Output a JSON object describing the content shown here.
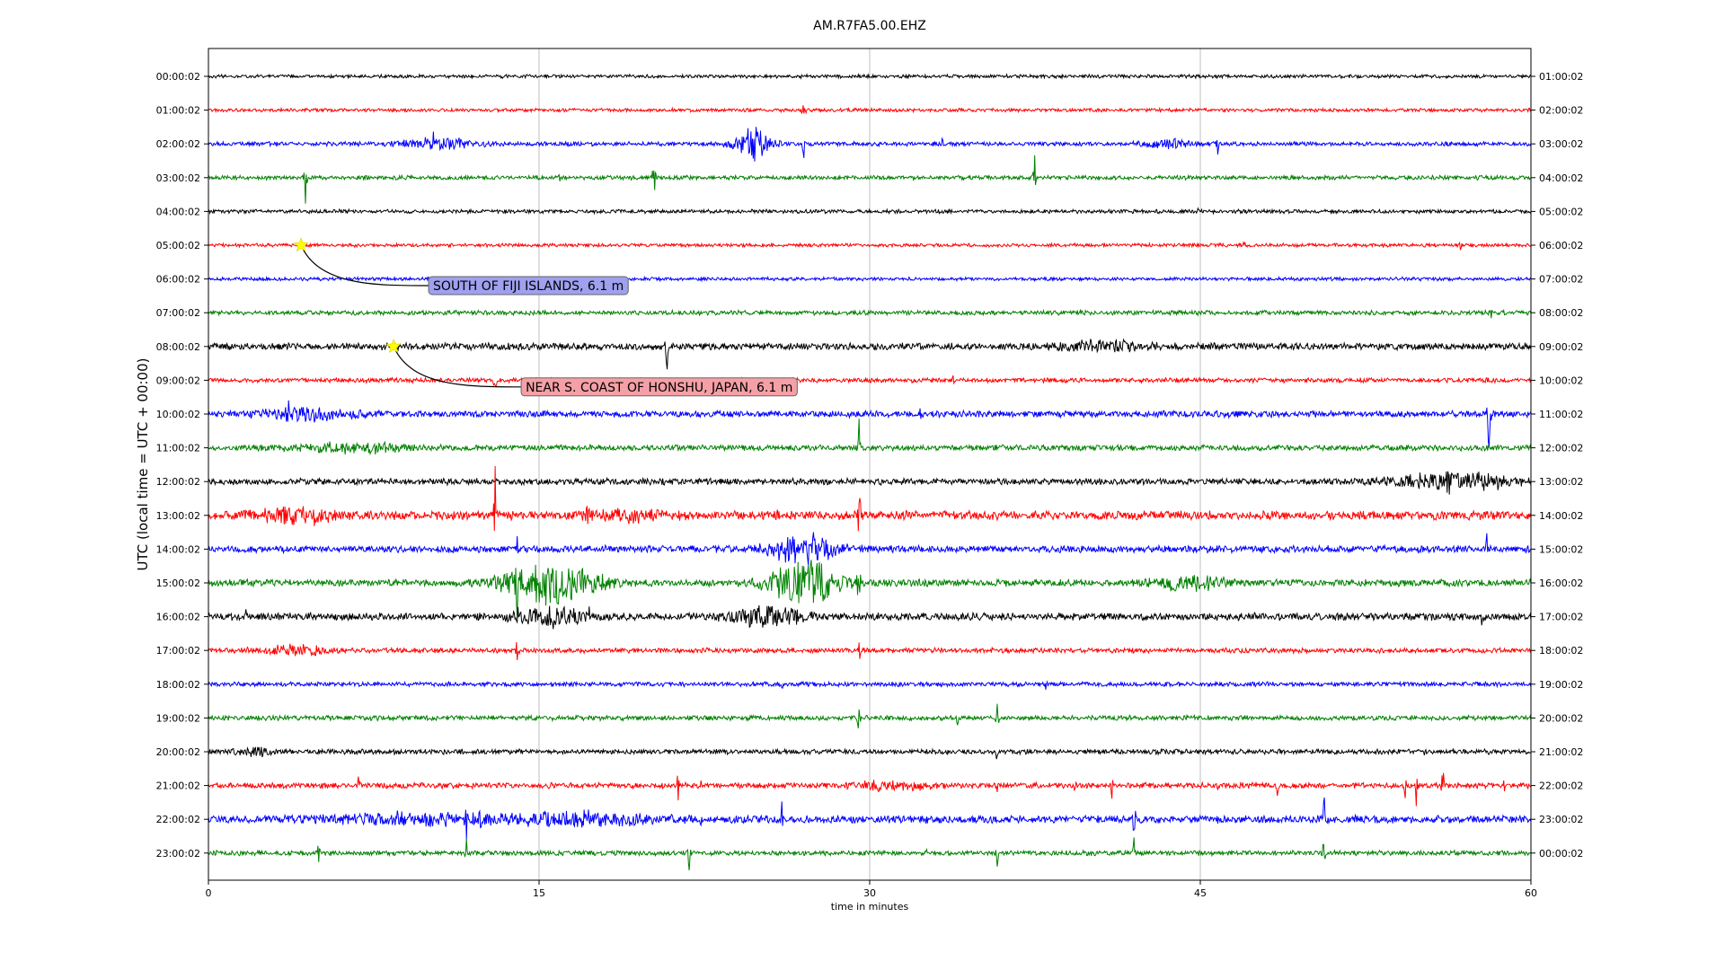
{
  "chart_data": {
    "type": "line",
    "title": "AM.R7FA5.00.EHZ",
    "xlabel": "time in minutes",
    "ylabel": "UTC (local time = UTC + 00:00)",
    "xlim": [
      0,
      60
    ],
    "x_ticks": [
      "0",
      "15",
      "30",
      "45",
      "60"
    ],
    "x_tick_values": [
      0,
      15,
      30,
      45,
      60
    ],
    "grid": "vertical lines at each x tick",
    "trace_colors": [
      "#000000",
      "#ff0000",
      "#0000ff",
      "#008000"
    ],
    "left_tick_labels": [
      "00:00:02",
      "01:00:02",
      "02:00:02",
      "03:00:02",
      "04:00:02",
      "05:00:02",
      "06:00:02",
      "07:00:02",
      "08:00:02",
      "09:00:02",
      "10:00:02",
      "11:00:02",
      "12:00:02",
      "13:00:02",
      "14:00:02",
      "15:00:02",
      "16:00:02",
      "17:00:02",
      "18:00:02",
      "19:00:02",
      "20:00:02",
      "21:00:02",
      "22:00:02",
      "23:00:02"
    ],
    "right_tick_labels": [
      "01:00:02",
      "02:00:02",
      "03:00:02",
      "04:00:02",
      "05:00:02",
      "06:00:02",
      "07:00:02",
      "08:00:02",
      "09:00:02",
      "10:00:02",
      "11:00:02",
      "12:00:02",
      "13:00:02",
      "14:00:02",
      "15:00:02",
      "16:00:02",
      "17:00:02",
      "18:00:02",
      "19:00:02",
      "20:00:02",
      "21:00:02",
      "22:00:02",
      "23:00:02",
      "00:00:02"
    ],
    "events": [
      {
        "label": "SOUTH OF FIJI ISLANDS, 6.1 m",
        "row": 5,
        "minute": 4.2,
        "box_color": "#9fa0ee"
      },
      {
        "label": "NEAR S. COAST OF HONSHU, JAPAN, 6.1 m",
        "row": 8,
        "minute": 8.4,
        "box_color": "#f5a0a6"
      }
    ],
    "series": [
      {
        "noise": 1.0,
        "bursts": [],
        "spikes": []
      },
      {
        "noise": 1.0,
        "bursts": [],
        "spikes": [
          {
            "minute": 27.0,
            "amp": 30
          }
        ]
      },
      {
        "noise": 1.2,
        "bursts": [
          {
            "minute": 10.5,
            "width": 1.5,
            "amp": 7
          },
          {
            "minute": 24.7,
            "width": 0.8,
            "amp": 20
          },
          {
            "minute": 43.5,
            "width": 1.0,
            "amp": 5
          }
        ],
        "spikes": [
          {
            "minute": 10.2,
            "amp": 28
          },
          {
            "minute": 27.0,
            "amp": 28
          },
          {
            "minute": 45.8,
            "amp": 34
          },
          {
            "minute": 33.3,
            "amp": 14
          }
        ]
      },
      {
        "noise": 1.2,
        "bursts": [],
        "spikes": [
          {
            "minute": 4.4,
            "amp": 34
          },
          {
            "minute": 20.2,
            "amp": 34
          },
          {
            "minute": 37.5,
            "amp": 28
          },
          {
            "minute": 15.9,
            "amp": 12
          }
        ]
      },
      {
        "noise": 1.1,
        "bursts": [],
        "spikes": [
          {
            "minute": 44.9,
            "amp": 6
          }
        ]
      },
      {
        "noise": 1.0,
        "bursts": [],
        "spikes": [
          {
            "minute": 47.0,
            "amp": 8
          },
          {
            "minute": 56.8,
            "amp": 8
          }
        ]
      },
      {
        "noise": 1.0,
        "bursts": [],
        "spikes": []
      },
      {
        "noise": 1.3,
        "bursts": [],
        "spikes": [
          {
            "minute": 58.2,
            "amp": 10
          }
        ]
      },
      {
        "noise": 2.0,
        "bursts": [
          {
            "minute": 40.5,
            "width": 2.0,
            "amp": 5
          }
        ],
        "spikes": [
          {
            "minute": 20.8,
            "amp": 38
          },
          {
            "minute": 41.5,
            "amp": 20
          }
        ]
      },
      {
        "noise": 1.3,
        "bursts": [],
        "spikes": [
          {
            "minute": 13.0,
            "amp": 24
          },
          {
            "minute": 33.8,
            "amp": 10
          }
        ]
      },
      {
        "noise": 1.8,
        "bursts": [
          {
            "minute": 4.5,
            "width": 2.0,
            "amp": 7
          }
        ],
        "spikes": [
          {
            "minute": 3.6,
            "amp": 44
          },
          {
            "minute": 58.1,
            "amp": 62
          },
          {
            "minute": 32.3,
            "amp": 14
          },
          {
            "minute": 50.2,
            "amp": 14
          }
        ]
      },
      {
        "noise": 1.6,
        "bursts": [
          {
            "minute": 6.5,
            "width": 2.5,
            "amp": 5
          }
        ],
        "spikes": [
          {
            "minute": 17.3,
            "amp": 22
          },
          {
            "minute": 29.5,
            "amp": 44
          }
        ]
      },
      {
        "noise": 1.8,
        "bursts": [
          {
            "minute": 56.5,
            "width": 2.5,
            "amp": 12
          }
        ],
        "spikes": [
          {
            "minute": 22.3,
            "amp": 12
          }
        ]
      },
      {
        "noise": 2.5,
        "bursts": [
          {
            "minute": 4.0,
            "width": 1.8,
            "amp": 8
          },
          {
            "minute": 19.0,
            "width": 1.8,
            "amp": 6
          }
        ],
        "spikes": [
          {
            "minute": 13.0,
            "amp": 60
          },
          {
            "minute": 17.2,
            "amp": 30
          },
          {
            "minute": 25.8,
            "amp": 30
          },
          {
            "minute": 29.5,
            "amp": 60
          }
        ]
      },
      {
        "noise": 2.0,
        "bursts": [
          {
            "minute": 27.0,
            "width": 1.5,
            "amp": 18
          }
        ],
        "spikes": [
          {
            "minute": 58.0,
            "amp": 24
          },
          {
            "minute": 14.0,
            "amp": 20
          }
        ]
      },
      {
        "noise": 2.0,
        "bursts": [
          {
            "minute": 15.5,
            "width": 2.0,
            "amp": 28
          },
          {
            "minute": 27.0,
            "width": 1.5,
            "amp": 30
          },
          {
            "minute": 44.5,
            "width": 1.5,
            "amp": 8
          }
        ],
        "spikes": [
          {
            "minute": 14.0,
            "amp": 60
          },
          {
            "minute": 29.5,
            "amp": 60
          }
        ]
      },
      {
        "noise": 2.1,
        "bursts": [
          {
            "minute": 15.5,
            "width": 1.5,
            "amp": 10
          },
          {
            "minute": 25.5,
            "width": 1.5,
            "amp": 12
          }
        ],
        "spikes": [
          {
            "minute": 1.7,
            "amp": 18
          },
          {
            "minute": 14.0,
            "amp": 50
          },
          {
            "minute": 17.3,
            "amp": 30
          },
          {
            "minute": 57.8,
            "amp": 26
          }
        ]
      },
      {
        "noise": 1.4,
        "bursts": [
          {
            "minute": 3.8,
            "width": 1.5,
            "amp": 6
          }
        ],
        "spikes": [
          {
            "minute": 14.0,
            "amp": 30
          },
          {
            "minute": 29.5,
            "amp": 22
          },
          {
            "minute": 18.5,
            "amp": 10
          }
        ]
      },
      {
        "noise": 1.3,
        "bursts": [],
        "spikes": [
          {
            "minute": 26.0,
            "amp": 12
          },
          {
            "minute": 38.0,
            "amp": 8
          }
        ]
      },
      {
        "noise": 1.4,
        "bursts": [],
        "spikes": [
          {
            "minute": 35.8,
            "amp": 26
          },
          {
            "minute": 29.5,
            "amp": 30
          },
          {
            "minute": 34.0,
            "amp": 10
          }
        ]
      },
      {
        "noise": 1.4,
        "bursts": [
          {
            "minute": 2.0,
            "width": 1.0,
            "amp": 4
          }
        ],
        "spikes": [
          {
            "minute": 35.8,
            "amp": 28
          },
          {
            "minute": 55.2,
            "amp": 10
          }
        ]
      },
      {
        "noise": 1.6,
        "bursts": [
          {
            "minute": 31.0,
            "width": 2.0,
            "amp": 4
          }
        ],
        "spikes": [
          {
            "minute": 6.8,
            "amp": 18
          },
          {
            "minute": 21.3,
            "amp": 28
          },
          {
            "minute": 22.3,
            "amp": 26
          },
          {
            "minute": 35.8,
            "amp": 22
          },
          {
            "minute": 39.3,
            "amp": 20
          },
          {
            "minute": 41.0,
            "amp": 20
          },
          {
            "minute": 45.8,
            "amp": 14
          },
          {
            "minute": 48.5,
            "amp": 22
          },
          {
            "minute": 54.3,
            "amp": 24
          },
          {
            "minute": 54.8,
            "amp": 28
          },
          {
            "minute": 56.0,
            "amp": 30
          },
          {
            "minute": 58.8,
            "amp": 18
          }
        ]
      },
      {
        "noise": 2.2,
        "bursts": [
          {
            "minute": 9.5,
            "width": 3.5,
            "amp": 6
          },
          {
            "minute": 17.0,
            "width": 3.0,
            "amp": 7
          }
        ],
        "spikes": [
          {
            "minute": 11.7,
            "amp": 40
          },
          {
            "minute": 12.3,
            "amp": 36
          },
          {
            "minute": 26.0,
            "amp": 24
          },
          {
            "minute": 32.6,
            "amp": 22
          },
          {
            "minute": 42.0,
            "amp": 36
          },
          {
            "minute": 50.6,
            "amp": 48
          },
          {
            "minute": 22.3,
            "amp": 20
          }
        ]
      },
      {
        "noise": 1.4,
        "bursts": [],
        "spikes": [
          {
            "minute": 5.0,
            "amp": 18
          },
          {
            "minute": 11.7,
            "amp": 20
          },
          {
            "minute": 21.8,
            "amp": 26
          },
          {
            "minute": 32.6,
            "amp": 10
          },
          {
            "minute": 35.8,
            "amp": 18
          },
          {
            "minute": 42.0,
            "amp": 20
          },
          {
            "minute": 50.6,
            "amp": 28
          }
        ]
      }
    ]
  }
}
